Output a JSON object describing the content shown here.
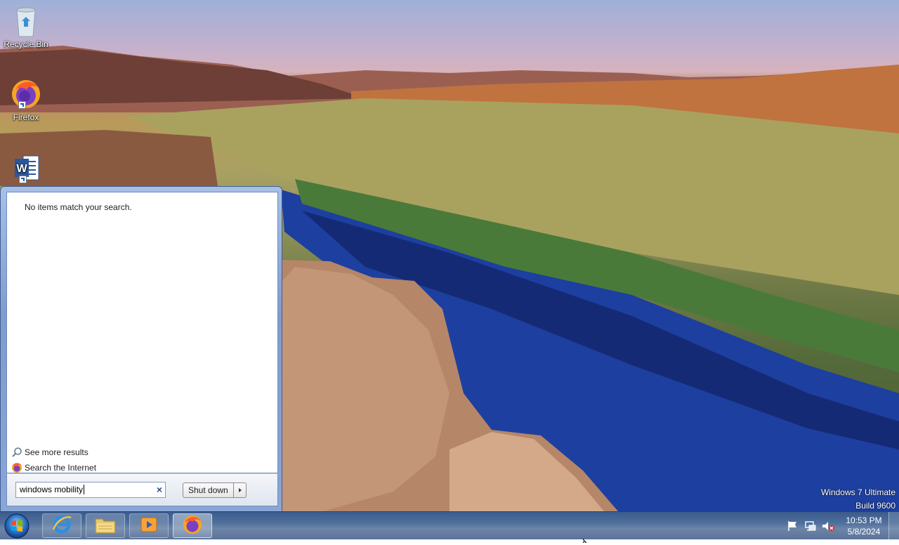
{
  "desktop": {
    "icons": [
      {
        "label": "Recycle Bin",
        "icon": "recycle-bin-icon"
      },
      {
        "label": "Firefox",
        "icon": "firefox-icon"
      },
      {
        "label": "",
        "icon": "word-icon"
      }
    ]
  },
  "start_menu": {
    "no_results_text": "No items match your search.",
    "see_more_results": "See more results",
    "search_internet": "Search the Internet",
    "search_value": "windows mobility",
    "shutdown_label": "Shut down"
  },
  "watermark": {
    "line1": "Windows 7 Ultimate",
    "line2": "Build 9600"
  },
  "taskbar": {
    "pinned": [
      "internet-explorer-icon",
      "windows-explorer-icon",
      "media-player-icon",
      "firefox-icon"
    ],
    "clock_time": "10:53 PM",
    "clock_date": "5/8/2024"
  },
  "colors": {
    "taskbar": "#4f6f9c",
    "start_menu_frame": "#8aa6d6",
    "accent_blue": "#1f4f9c"
  }
}
